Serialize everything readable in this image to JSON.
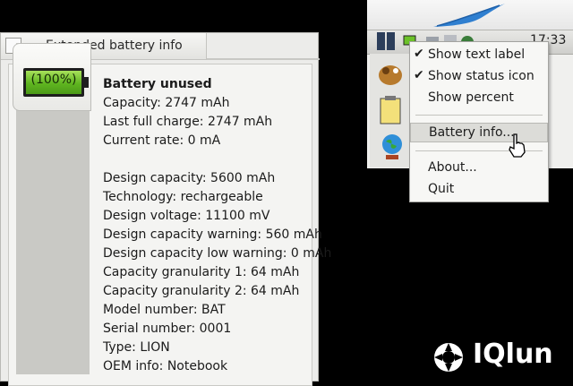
{
  "window": {
    "title": "Extended battery info",
    "battery_percent_label": "(100%)",
    "battery_level": 1.0,
    "status_heading": "Battery unused",
    "lines_group1": [
      "Capacity: 2747 mAh",
      "Last full charge: 2747 mAh",
      "Current rate: 0 mA"
    ],
    "lines_group2": [
      "Design capacity: 5600 mAh",
      "Technology: rechargeable",
      "Design voltage: 11100 mV",
      "Design capacity warning: 560 mAh",
      "Design capacity low warning: 0 mAh",
      "Capacity granularity 1: 64 mAh",
      "Capacity granularity 2: 64 mAh",
      "Model number: BAT",
      "Serial number: 0001",
      "Type: LION",
      "OEM info: Notebook"
    ]
  },
  "panel": {
    "clock": "17:33"
  },
  "menu": {
    "items": [
      {
        "label": "Show text label",
        "checked": "✔"
      },
      {
        "label": "Show status icon",
        "checked": "✔"
      },
      {
        "label": "Show percent",
        "checked": ""
      },
      {
        "label": "Battery info...",
        "checked": ""
      },
      {
        "label": "About...",
        "checked": ""
      },
      {
        "label": "Quit",
        "checked": ""
      }
    ]
  },
  "watermark": {
    "text": "IQlun"
  },
  "colors": {
    "battery_fill": "#5fb520",
    "background": "#000000",
    "panel": "#f0f0ee"
  }
}
